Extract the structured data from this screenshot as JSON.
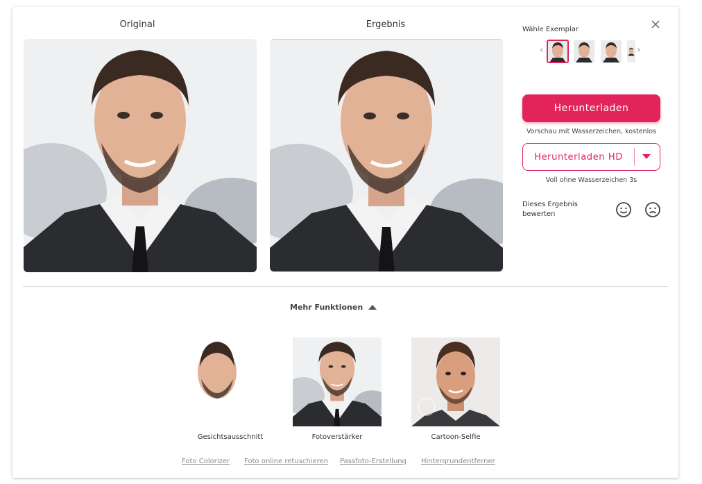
{
  "columns": {
    "original_title": "Original",
    "result_title": "Ergebnis"
  },
  "sidebar": {
    "choose_label": "Wähle Exemplar",
    "download_label": "Herunterladen",
    "download_note": "Vorschau mit Wasserzeichen, kostenlos",
    "download_hd_label": "Herunterladen HD",
    "download_hd_note": "Voll ohne Wasserzeichen 3s",
    "rate_label": "Dieses Ergebnis bewerten"
  },
  "more_functions": {
    "label": "Mehr Funktionen",
    "features": [
      {
        "label": "Gesichtsausschnitt"
      },
      {
        "label": "Fotoverstärker"
      },
      {
        "label": "Cartoon-Selfie"
      }
    ],
    "links": [
      "Foto Colorizer",
      "Foto online retuschieren",
      "Passfoto-Erstellung",
      "Hintergrundentferner"
    ]
  },
  "colors": {
    "accent": "#e3245a"
  },
  "icons": [
    "close-icon",
    "chevron-left-icon",
    "chevron-right-icon",
    "smile-icon",
    "frown-icon",
    "caret-down-icon",
    "caret-up-icon"
  ]
}
